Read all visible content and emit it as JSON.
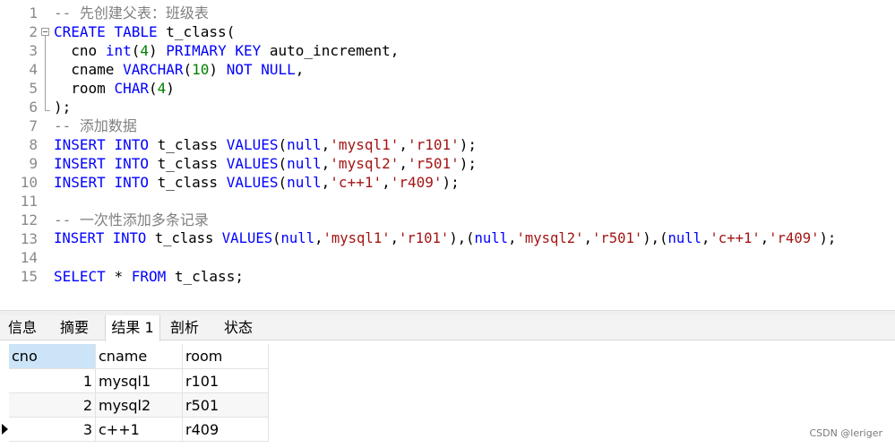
{
  "editor": {
    "line_numbers": [
      "1",
      "2",
      "3",
      "4",
      "5",
      "6",
      "7",
      "8",
      "9",
      "10",
      "11",
      "12",
      "13",
      "14",
      "15"
    ],
    "comment1": "-- 先创建父表：班级表",
    "comment2": "-- 添加数据",
    "comment3": "-- 一次性添加多条记录",
    "kw_create": "CREATE",
    "kw_table": "TABLE",
    "kw_int": "int",
    "kw_primary": "PRIMARY",
    "kw_key": "KEY",
    "kw_varchar": "VARCHAR",
    "kw_not": "NOT",
    "kw_null_upper": "NULL",
    "kw_char": "CHAR",
    "kw_insert": "INSERT",
    "kw_into": "INTO",
    "kw_values": "VALUES",
    "kw_select": "SELECT",
    "kw_from": "FROM",
    "n4": "4",
    "n10": "10",
    "table_name": "t_class",
    "col_cno": "cno",
    "col_cname": "cname",
    "col_room": "room",
    "auto_inc": "auto_increment,",
    "null_lower": "null",
    "s_mysql1": "'mysql1'",
    "s_mysql2": "'mysql2'",
    "s_cpp": "'c++1'",
    "s_r101": "'r101'",
    "s_r501": "'r501'",
    "s_r409": "'r409'",
    "star": "*"
  },
  "tabs": [
    "信息",
    "摘要",
    "结果 1",
    "剖析",
    "状态"
  ],
  "active_tab": "结果 1",
  "result": {
    "columns": [
      "cno",
      "cname",
      "room"
    ],
    "rows": [
      [
        "1",
        "mysql1",
        "r101"
      ],
      [
        "2",
        "mysql2",
        "r501"
      ],
      [
        "3",
        "c++1",
        "r409"
      ]
    ]
  },
  "watermark": "CSDN @leriger",
  "colors": {
    "keyword": "#0000ff",
    "number": "#008000",
    "string": "#a31515",
    "comment": "#808080",
    "selected_header": "#cce4f7"
  }
}
